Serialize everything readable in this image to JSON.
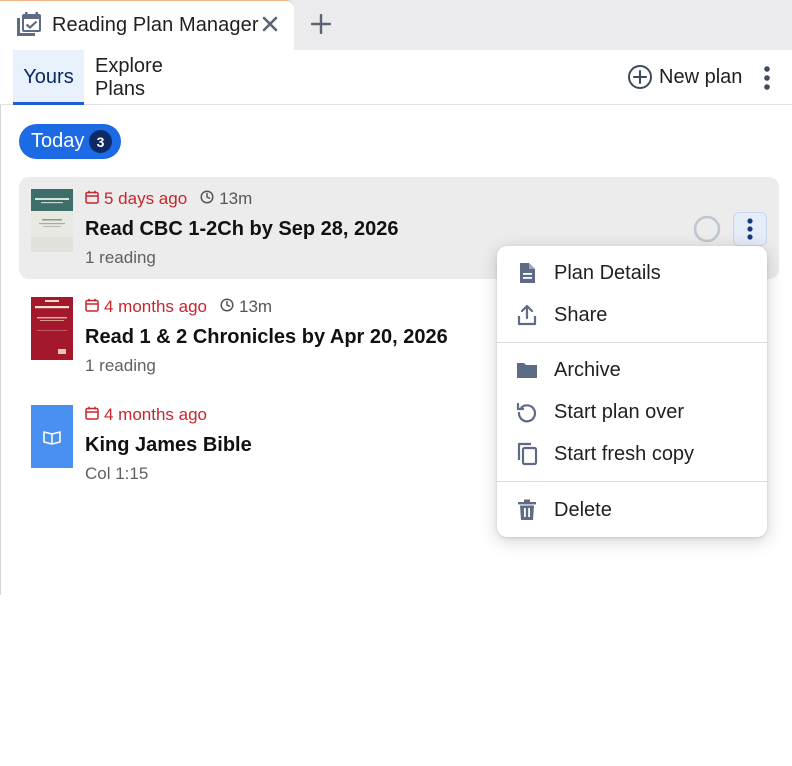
{
  "tab": {
    "title": "Reading Plan Manager",
    "icon": "calendar-check-icon"
  },
  "header": {
    "tabs": [
      {
        "label": "Yours",
        "active": true
      },
      {
        "label": "Explore Plans",
        "active": false
      }
    ],
    "new_plan_label": "New plan"
  },
  "today": {
    "label": "Today",
    "count": "3"
  },
  "plans": [
    {
      "when": "5 days ago",
      "duration": "13m",
      "title": "Read CBC 1-2Ch by Sep 28, 2026",
      "subtitle": "1 reading",
      "progress": 0
    },
    {
      "when": "4 months ago",
      "duration": "13m",
      "title": "Read 1 & 2 Chronicles by Apr 20, 2026",
      "subtitle": "1 reading"
    },
    {
      "when": "4 months ago",
      "title": "King James Bible",
      "subtitle": "Col 1:15"
    }
  ],
  "menu": {
    "items": [
      {
        "label": "Plan Details",
        "icon": "document-icon"
      },
      {
        "label": "Share",
        "icon": "share-icon"
      },
      {
        "label": "Archive",
        "icon": "folder-icon"
      },
      {
        "label": "Start plan over",
        "icon": "restart-icon"
      },
      {
        "label": "Start fresh copy",
        "icon": "copy-icon"
      },
      {
        "label": "Delete",
        "icon": "trash-icon"
      }
    ]
  },
  "colors": {
    "accent": "#1d6ae5",
    "badge": "#0e2a66",
    "due": "#c8252c",
    "active_tab_bg": "#e8f1fc"
  }
}
